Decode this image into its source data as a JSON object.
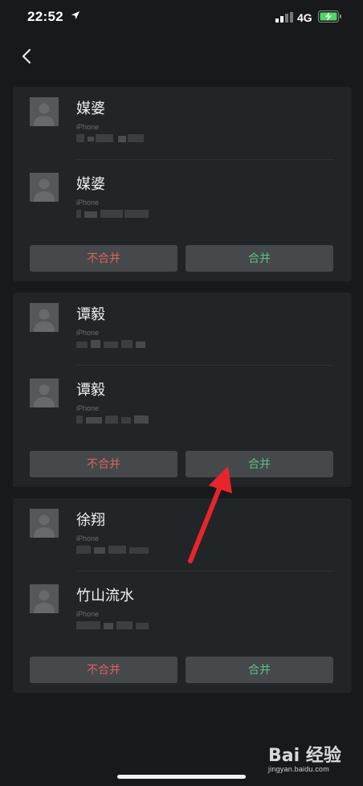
{
  "status_bar": {
    "time": "22:52",
    "network": "4G"
  },
  "nav": {
    "back_icon": "chevron-left-icon"
  },
  "groups": [
    {
      "contacts": [
        {
          "name": "媒婆",
          "device": "iPhone",
          "number_redacted": true
        },
        {
          "name": "媒婆",
          "device": "iPhone",
          "number_redacted": true
        }
      ],
      "buttons": {
        "no_merge": "不合并",
        "merge": "合并"
      }
    },
    {
      "contacts": [
        {
          "name": "谭毅",
          "device": "iPhone",
          "number_redacted": true
        },
        {
          "name": "谭毅",
          "device": "iPhone",
          "number_redacted": true
        }
      ],
      "buttons": {
        "no_merge": "不合并",
        "merge": "合并"
      }
    },
    {
      "contacts": [
        {
          "name": "徐翔",
          "device": "iPhone",
          "number_redacted": true
        },
        {
          "name": "竹山流水",
          "device": "iPhone",
          "number_redacted": true
        }
      ],
      "buttons": {
        "no_merge": "不合并",
        "merge": "合并"
      }
    }
  ],
  "colors": {
    "background": "#17191b",
    "card": "#212527",
    "button": "#45494b",
    "no_merge_text": "#e0605a",
    "merge_text": "#5dbf86",
    "annotation_arrow": "#e8252b",
    "battery": "#4cd964"
  },
  "watermark": {
    "logo": "Bai 经验",
    "url": "jingyan.baidu.com"
  }
}
